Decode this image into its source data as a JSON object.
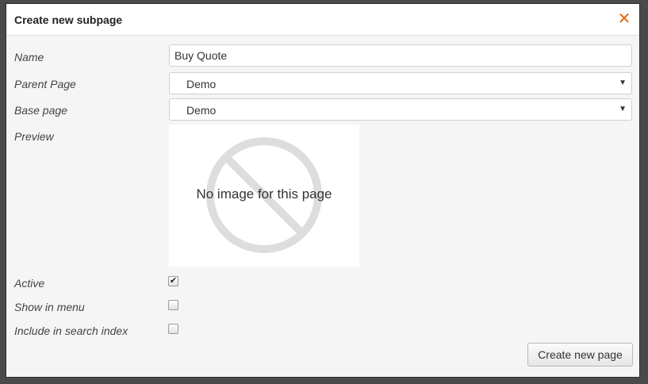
{
  "dialog": {
    "title": "Create new subpage",
    "close_icon": "close-icon"
  },
  "form": {
    "name_label": "Name",
    "name_value": "Buy Quote",
    "parent_label": "Parent Page",
    "parent_value": "Demo",
    "base_label": "Base page",
    "base_value": "Demo",
    "preview_label": "Preview",
    "preview_text": "No image for this page",
    "active_label": "Active",
    "active_checked": true,
    "menu_label": "Show in menu",
    "menu_checked": false,
    "search_label": "Include in search index",
    "search_checked": false
  },
  "actions": {
    "create_label": "Create new page"
  },
  "colors": {
    "accent": "#e8650e",
    "placeholder_symbol": "#dddddd"
  }
}
